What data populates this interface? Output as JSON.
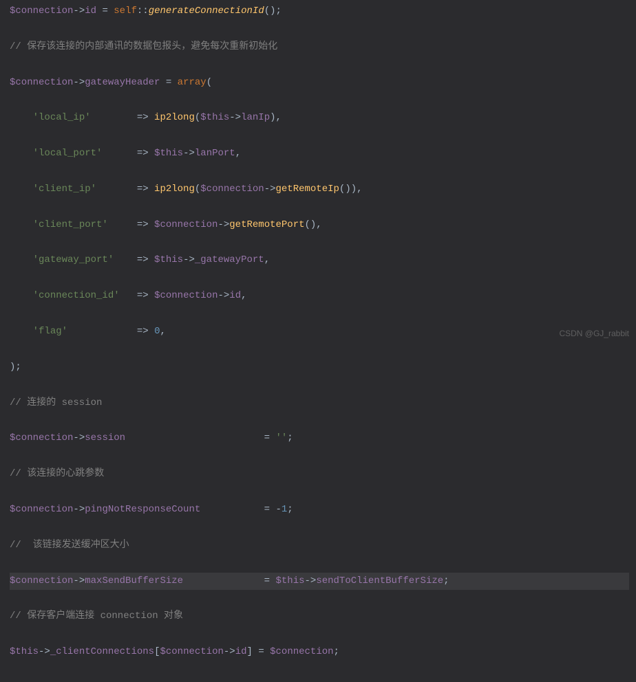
{
  "lines": [
    {
      "type": "code",
      "segments": [
        {
          "cls": "var",
          "t": "$connection"
        },
        {
          "cls": "arrow",
          "t": "->"
        },
        {
          "cls": "prop",
          "t": "id"
        },
        {
          "cls": "plain",
          "t": " = "
        },
        {
          "cls": "kw",
          "t": "self"
        },
        {
          "cls": "plain",
          "t": "::"
        },
        {
          "cls": "methodi",
          "t": "generateConnectionId"
        },
        {
          "cls": "plain",
          "t": "();"
        }
      ]
    },
    {
      "type": "code",
      "segments": [
        {
          "cls": "cmt",
          "t": "// 保存该连接的内部通讯的数据包报头，避免每次重新初始化"
        }
      ]
    },
    {
      "type": "code",
      "segments": [
        {
          "cls": "var",
          "t": "$connection"
        },
        {
          "cls": "arrow",
          "t": "->"
        },
        {
          "cls": "prop",
          "t": "gatewayHeader"
        },
        {
          "cls": "plain",
          "t": " = "
        },
        {
          "cls": "kw",
          "t": "array"
        },
        {
          "cls": "plain",
          "t": "("
        }
      ]
    },
    {
      "type": "code",
      "segments": [
        {
          "cls": "plain",
          "t": "    "
        },
        {
          "cls": "str",
          "t": "'local_ip'"
        },
        {
          "cls": "plain",
          "t": "        => "
        },
        {
          "cls": "func",
          "t": "ip2long"
        },
        {
          "cls": "plain",
          "t": "("
        },
        {
          "cls": "var",
          "t": "$this"
        },
        {
          "cls": "arrow",
          "t": "->"
        },
        {
          "cls": "prop",
          "t": "lanIp"
        },
        {
          "cls": "plain",
          "t": "),"
        }
      ]
    },
    {
      "type": "code",
      "segments": [
        {
          "cls": "plain",
          "t": "    "
        },
        {
          "cls": "str",
          "t": "'local_port'"
        },
        {
          "cls": "plain",
          "t": "      => "
        },
        {
          "cls": "var",
          "t": "$this"
        },
        {
          "cls": "arrow",
          "t": "->"
        },
        {
          "cls": "prop",
          "t": "lanPort"
        },
        {
          "cls": "plain",
          "t": ","
        }
      ]
    },
    {
      "type": "code",
      "segments": [
        {
          "cls": "plain",
          "t": "    "
        },
        {
          "cls": "str",
          "t": "'client_ip'"
        },
        {
          "cls": "plain",
          "t": "       => "
        },
        {
          "cls": "func",
          "t": "ip2long"
        },
        {
          "cls": "plain",
          "t": "("
        },
        {
          "cls": "var",
          "t": "$connection"
        },
        {
          "cls": "arrow",
          "t": "->"
        },
        {
          "cls": "method",
          "t": "getRemoteIp"
        },
        {
          "cls": "plain",
          "t": "()),"
        }
      ]
    },
    {
      "type": "code",
      "segments": [
        {
          "cls": "plain",
          "t": "    "
        },
        {
          "cls": "str",
          "t": "'client_port'"
        },
        {
          "cls": "plain",
          "t": "     => "
        },
        {
          "cls": "var",
          "t": "$connection"
        },
        {
          "cls": "arrow",
          "t": "->"
        },
        {
          "cls": "method",
          "t": "getRemotePort"
        },
        {
          "cls": "plain",
          "t": "(),"
        }
      ]
    },
    {
      "type": "code",
      "segments": [
        {
          "cls": "plain",
          "t": "    "
        },
        {
          "cls": "str",
          "t": "'gateway_port'"
        },
        {
          "cls": "plain",
          "t": "    => "
        },
        {
          "cls": "var",
          "t": "$this"
        },
        {
          "cls": "arrow",
          "t": "->"
        },
        {
          "cls": "prop",
          "t": "_gatewayPort"
        },
        {
          "cls": "plain",
          "t": ","
        }
      ]
    },
    {
      "type": "code",
      "segments": [
        {
          "cls": "plain",
          "t": "    "
        },
        {
          "cls": "str",
          "t": "'connection_id'"
        },
        {
          "cls": "plain",
          "t": "   => "
        },
        {
          "cls": "var",
          "t": "$connection"
        },
        {
          "cls": "arrow",
          "t": "->"
        },
        {
          "cls": "prop",
          "t": "id"
        },
        {
          "cls": "plain",
          "t": ","
        }
      ]
    },
    {
      "type": "code",
      "segments": [
        {
          "cls": "plain",
          "t": "    "
        },
        {
          "cls": "str",
          "t": "'flag'"
        },
        {
          "cls": "plain",
          "t": "            => "
        },
        {
          "cls": "num",
          "t": "0"
        },
        {
          "cls": "plain",
          "t": ","
        }
      ]
    },
    {
      "type": "code",
      "segments": [
        {
          "cls": "plain",
          "t": ");"
        }
      ]
    },
    {
      "type": "code",
      "segments": [
        {
          "cls": "cmt",
          "t": "// 连接的 session"
        }
      ]
    },
    {
      "type": "code",
      "segments": [
        {
          "cls": "var",
          "t": "$connection"
        },
        {
          "cls": "arrow",
          "t": "->"
        },
        {
          "cls": "prop",
          "t": "session"
        },
        {
          "cls": "plain",
          "t": "                        = "
        },
        {
          "cls": "str",
          "t": "''"
        },
        {
          "cls": "plain",
          "t": ";"
        }
      ]
    },
    {
      "type": "code",
      "segments": [
        {
          "cls": "cmt",
          "t": "// 该连接的心跳参数"
        }
      ]
    },
    {
      "type": "code",
      "segments": [
        {
          "cls": "var",
          "t": "$connection"
        },
        {
          "cls": "arrow",
          "t": "->"
        },
        {
          "cls": "prop",
          "t": "pingNotResponseCount"
        },
        {
          "cls": "plain",
          "t": "           = -"
        },
        {
          "cls": "num",
          "t": "1"
        },
        {
          "cls": "plain",
          "t": ";"
        }
      ]
    },
    {
      "type": "code",
      "segments": [
        {
          "cls": "cmt",
          "t": "//  该链接发送缓冲区大小"
        }
      ]
    },
    {
      "type": "code",
      "hl": true,
      "segments": [
        {
          "cls": "var",
          "t": "$connection"
        },
        {
          "cls": "arrow",
          "t": "->"
        },
        {
          "cls": "prop",
          "t": "maxSendBufferSize"
        },
        {
          "cls": "plain",
          "t": "              = "
        },
        {
          "cls": "var",
          "t": "$this"
        },
        {
          "cls": "arrow",
          "t": "->"
        },
        {
          "cls": "prop",
          "t": "sendToClientBufferSize"
        },
        {
          "cls": "plain",
          "t": ";"
        }
      ]
    },
    {
      "type": "code",
      "segments": [
        {
          "cls": "cmt",
          "t": "// 保存客户端连接 connection 对象"
        }
      ]
    },
    {
      "type": "code",
      "segments": [
        {
          "cls": "var",
          "t": "$this"
        },
        {
          "cls": "arrow",
          "t": "->"
        },
        {
          "cls": "prop",
          "t": "_clientConnections"
        },
        {
          "cls": "plain",
          "t": "["
        },
        {
          "cls": "var",
          "t": "$connection"
        },
        {
          "cls": "arrow",
          "t": "->"
        },
        {
          "cls": "prop",
          "t": "id"
        },
        {
          "cls": "plain",
          "t": "] = "
        },
        {
          "cls": "var",
          "t": "$connection"
        },
        {
          "cls": "plain",
          "t": ";"
        }
      ]
    }
  ],
  "watermark": "CSDN @GJ_rabbit"
}
